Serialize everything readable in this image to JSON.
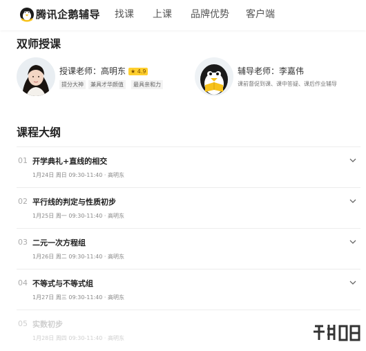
{
  "header": {
    "brand": "腾讯企鹅辅导",
    "nav": [
      "找课",
      "上课",
      "品牌优势",
      "客户端"
    ]
  },
  "teachers_section": {
    "title": "双师授课",
    "lead": {
      "name": "授课老师：高明东",
      "rating": "4.9",
      "tags": [
        "提分大神",
        "兼具才华颜值",
        "最具亲和力"
      ]
    },
    "assistant": {
      "name": "辅导老师：李嘉伟",
      "desc": "课前督促到课、课中答疑、课后作业辅导"
    }
  },
  "outline": {
    "title": "课程大纲",
    "lessons": [
      {
        "num": "01",
        "title": "开学典礼+直线的相交",
        "meta": "1月24日 周日 09:30-11:40 · 高明东"
      },
      {
        "num": "02",
        "title": "平行线的判定与性质初步",
        "meta": "1月25日 周一 09:30-11:40 · 高明东"
      },
      {
        "num": "03",
        "title": "二元一次方程组",
        "meta": "1月26日 周二 09:30-11:40 · 高明东"
      },
      {
        "num": "04",
        "title": "不等式与不等式组",
        "meta": "1月27日 周三 09:30-11:40 · 高明东"
      },
      {
        "num": "05",
        "title": "实数初步",
        "meta": "1月28日 周四 09:30-11:40 · 高明东"
      }
    ]
  },
  "colors": {
    "brand_yellow": "#f7c21a",
    "rating_bg": "#ffcf2e",
    "divider": "#ececec"
  },
  "icons": [
    "penguin-logo-icon",
    "chevron-down-icon",
    "rating-badge-icon"
  ]
}
